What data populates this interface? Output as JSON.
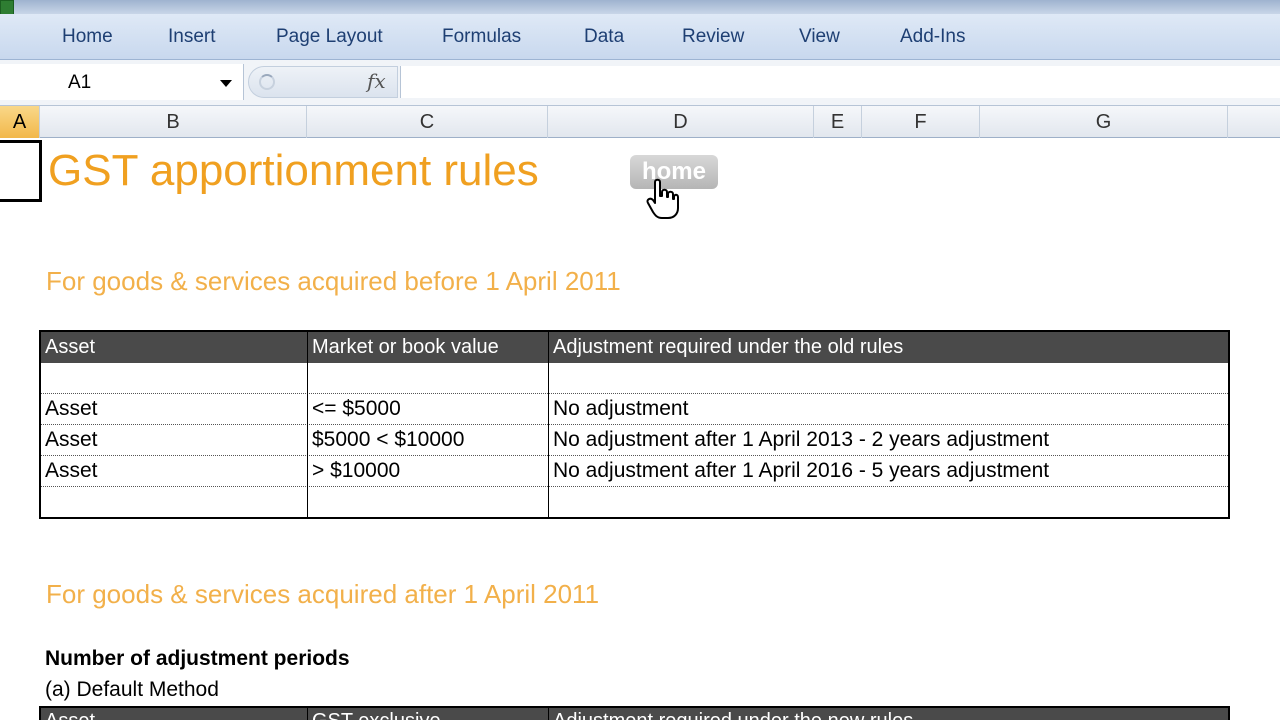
{
  "ribbon": {
    "tabs": [
      "Home",
      "Insert",
      "Page Layout",
      "Formulas",
      "Data",
      "Review",
      "View",
      "Add-Ins"
    ]
  },
  "formula_bar": {
    "name_box": "A1",
    "fx": "fx",
    "formula": ""
  },
  "columns": [
    "A",
    "B",
    "C",
    "D",
    "E",
    "F",
    "G"
  ],
  "sheet": {
    "title": "GST apportionment rules",
    "home_button": "home",
    "section1_heading": "For goods & services acquired before 1 April 2011",
    "table1": {
      "headers": [
        "Asset",
        "Market or book value",
        "Adjustment required under the old rules"
      ],
      "rows": [
        [
          "",
          "",
          ""
        ],
        [
          "Asset",
          "<= $5000",
          "No adjustment"
        ],
        [
          "Asset",
          "$5000 < $10000",
          "No adjustment after 1 April 2013 - 2 years adjustment"
        ],
        [
          "Asset",
          "> $10000",
          "No adjustment after 1 April 2016 - 5 years adjustment"
        ],
        [
          "",
          "",
          ""
        ]
      ]
    },
    "section2_heading": "For goods & services acquired after 1 April 2011",
    "adjustment_periods_label": "Number of adjustment periods",
    "default_method_label": "(a) Default Method",
    "table2": {
      "headers": [
        "Asset",
        "GST exclusive",
        "Adjustment required under the new rules"
      ]
    }
  },
  "colors": {
    "title_orange": "#f0a020",
    "heading_orange": "#f2b04a",
    "table_header_bg": "#4a4a4a",
    "ribbon_text": "#1e3f73"
  }
}
